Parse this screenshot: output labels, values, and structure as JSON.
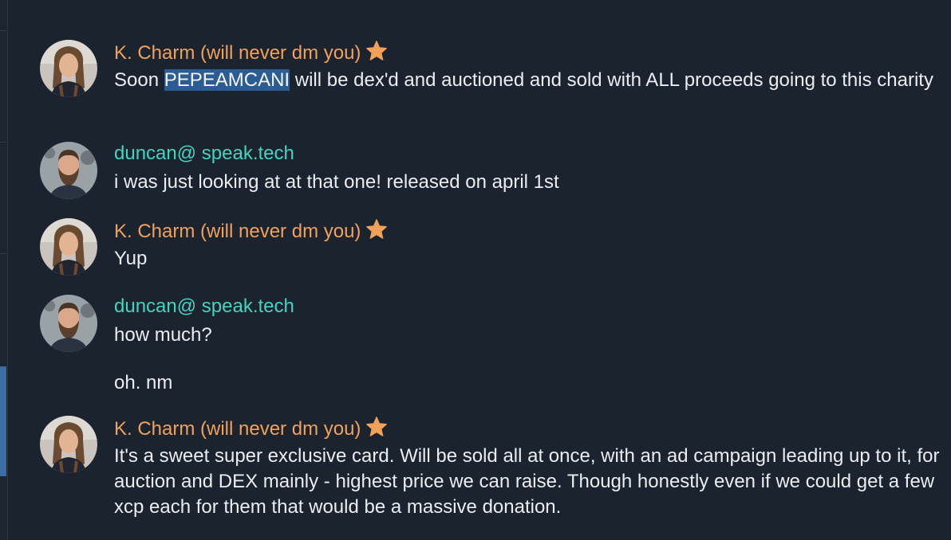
{
  "colors": {
    "background": "#1b232e",
    "kcharm_name": "#f0a25a",
    "duncan_name": "#43d3bf",
    "message_text": "#ebedf0",
    "selection": "#2b5d94",
    "scroll_thumb": "#3b6fa3"
  },
  "messages": [
    {
      "author": "K. Charm (will never dm you)",
      "author_icon": "star-icon",
      "avatar": "avatar-long-hair",
      "text_before": "Soon ",
      "text_selected": "PEPEAMCANI",
      "text_after": " will be dex'd and auctioned and sold with ALL proceeds going to this charity"
    },
    {
      "author": "duncan@ speak.tech",
      "avatar": "avatar-bearded",
      "text": "i was just looking at at that one! released on april 1st"
    },
    {
      "author": "K. Charm (will never dm you)",
      "author_icon": "star-icon",
      "avatar": "avatar-long-hair",
      "text": "Yup"
    },
    {
      "author": "duncan@ speak.tech",
      "avatar": "avatar-bearded",
      "text": "how much?",
      "text2": "oh. nm"
    },
    {
      "author": "K. Charm (will never dm you)",
      "author_icon": "star-icon",
      "avatar": "avatar-long-hair",
      "text": "It's a sweet super exclusive card.  Will be sold all at once, with an ad campaign leading up to it, for auction and DEX mainly - highest price we can raise.  Though honestly even if we could get a few xcp each for them that would be a massive donation."
    }
  ]
}
